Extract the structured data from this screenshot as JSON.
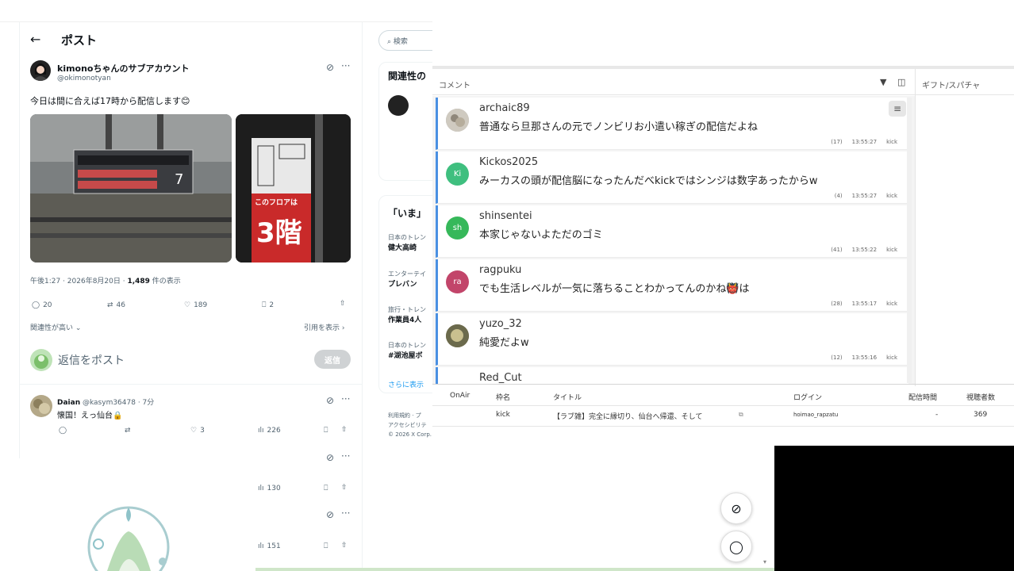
{
  "post": {
    "header_title": "ポスト",
    "author_name": "kimonoちゃんのサブアカウント",
    "author_handle": "@okimonotyan",
    "body": "今日は間に合えば17時から配信します😊",
    "meta_time": "午後1:27 · 2026年8月20日 · ",
    "meta_views": "1,489",
    "meta_views_suffix": " 件の表示",
    "replies": "20",
    "reposts": "46",
    "likes": "189",
    "bookmarks": "2",
    "relevance": "関連性が高い",
    "quote_link": "引用を表示",
    "reply_placeholder": "返信をポスト",
    "reply_button": "返信",
    "sign_board_text": "このフロアは",
    "sign_board_floor": "3階"
  },
  "replies": [
    {
      "name": "Daian",
      "handle": "@kasym36478 · 7分",
      "text": "懐国！えっ仙台🔒",
      "stat": "3",
      "views": "226"
    },
    {
      "views": "130"
    },
    {
      "views": "151"
    }
  ],
  "right_col": {
    "search_placeholder": "検索",
    "related_title": "関連性の",
    "now_title": "「いま」",
    "trends": [
      {
        "cat": "日本のトレン",
        "name": "健大高崎"
      },
      {
        "cat": "エンターテイ",
        "name": "プレバン"
      },
      {
        "cat": "旅行・トレン",
        "name": "作業員4人"
      },
      {
        "cat": "日本のトレン",
        "name": "#湖池屋ボ"
      }
    ],
    "more": "さらに表示",
    "footer1": "利用規約 · プ",
    "footer2": "アクセシビリテ",
    "footer3": "© 2026 X Corp."
  },
  "comments_panel": {
    "title": "コメント",
    "gift_title": "ギフト/スパチャ",
    "items": [
      {
        "user": "archaic89",
        "text": "普通なら旦那さんの元でノンビリお小遣い稼ぎの配信だよね",
        "count": "(17)",
        "time": "13:55:27",
        "src": "kick",
        "avatar": "",
        "color": "#9a9a9a"
      },
      {
        "user": "Kickos2025",
        "text": "みーカスの頭が配信脳になったんだべkickではシンジは数字あったからw",
        "count": "(4)",
        "time": "13:55:27",
        "src": "kick",
        "avatar": "Ki",
        "color": "#3fbf7f"
      },
      {
        "user": "shinsentei",
        "text": "本家じゃないよただのゴミ",
        "count": "(41)",
        "time": "13:55:22",
        "src": "kick",
        "avatar": "sh",
        "color": "#36b85a"
      },
      {
        "user": "ragpuku",
        "text": "でも生活レベルが一気に落ちることわかってんのかね👹は",
        "count": "(28)",
        "time": "13:55:17",
        "src": "kick",
        "avatar": "ra",
        "color": "#c2456a"
      },
      {
        "user": "yuzo_32",
        "text": "純愛だよw",
        "count": "(12)",
        "time": "13:55:16",
        "src": "kick",
        "avatar": "",
        "color": "#8a8058"
      },
      {
        "user": "Red_Cut",
        "text": "",
        "count": "",
        "time": "",
        "src": "",
        "avatar": "",
        "color": "#fff"
      }
    ],
    "table_headers": [
      "OnAir",
      "枠名",
      "タイトル",
      "ログイン",
      "配信時間",
      "視聴者数"
    ],
    "table_row": {
      "onair": "",
      "frame": "kick",
      "title": "【ラブ雑】完全に縁切り、仙台へ帰還、そして",
      "login": "hoimao_rapzatu",
      "duration": "-",
      "viewers": "369"
    }
  }
}
